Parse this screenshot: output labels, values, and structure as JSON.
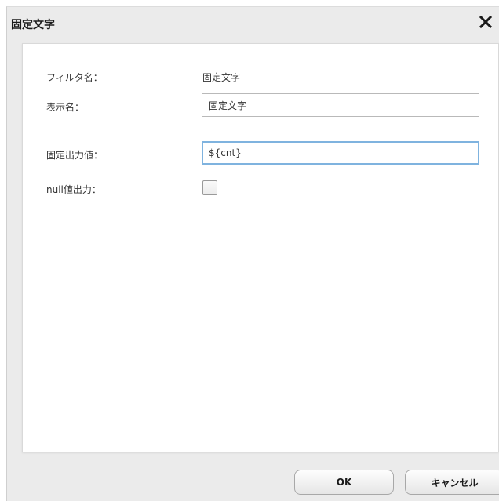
{
  "dialog": {
    "title": "固定文字",
    "close_icon": "close-icon"
  },
  "form": {
    "filter_name_label": "フィルタ名：",
    "filter_name_value": "固定文字",
    "display_name_label": "表示名：",
    "display_name_value": "固定文字",
    "fixed_output_label": "固定出力値：",
    "fixed_output_value": "${cnt}",
    "null_output_label": "null値出力：",
    "null_output_checked": false
  },
  "buttons": {
    "ok_label": "OK",
    "cancel_label": "キャンセル"
  },
  "colors": {
    "focus_border": "#7fb3df",
    "dialog_background": "#ebebeb",
    "panel_background": "#ffffff"
  }
}
